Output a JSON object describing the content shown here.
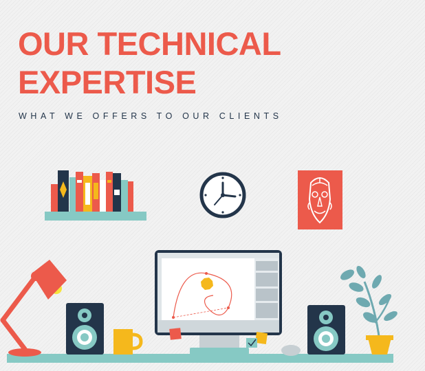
{
  "header": {
    "title_line1": "OUR TECHNICAL",
    "title_line2": "EXPERTISE",
    "subtitle": "WHAT WE OFFERS TO OUR CLIENTS"
  },
  "illustration": {
    "icons": [
      "bookshelf-icon",
      "wall-clock-icon",
      "tribal-mask-poster-icon",
      "desk-lamp-icon",
      "speaker-icon",
      "coffee-mug-icon",
      "desktop-monitor-icon",
      "computer-mouse-icon",
      "potted-plant-icon"
    ]
  },
  "colors": {
    "accent": "#ec5a4b",
    "navy": "#23354a",
    "teal": "#86c9c4",
    "yellow": "#f5b81c",
    "background": "#f2f2f2"
  }
}
